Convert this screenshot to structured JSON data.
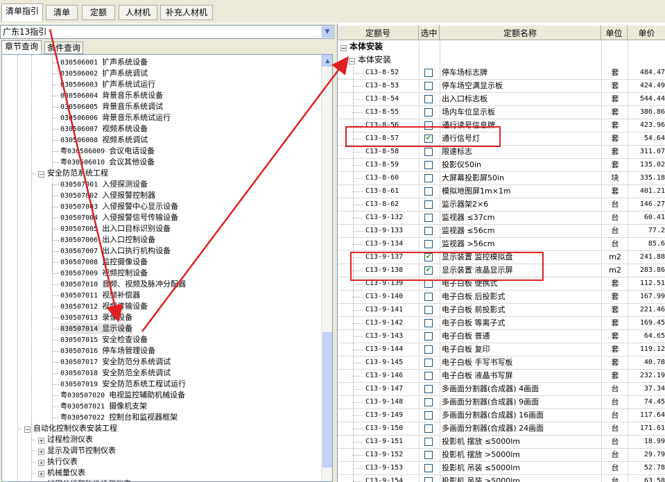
{
  "top_tabs": [
    "清单指引",
    "清单",
    "定额",
    "人材机",
    "补充人材机"
  ],
  "library": {
    "selected": "广东13指引"
  },
  "sub_tabs": [
    "章节查询",
    "条件查询"
  ],
  "tree": {
    "rows": [
      {
        "code": "030506001",
        "name": "扩声系统设备"
      },
      {
        "code": "030506002",
        "name": "扩声系统调试"
      },
      {
        "code": "030506003",
        "name": "扩声系统试运行"
      },
      {
        "code": "030506004",
        "name": "背景音乐系统设备"
      },
      {
        "code": "030506005",
        "name": "背景音乐系统调试"
      },
      {
        "code": "030506006",
        "name": "背景音乐系统试运行"
      },
      {
        "code": "030506007",
        "name": "视频系统设备"
      },
      {
        "code": "030506008",
        "name": "视频系统调试"
      },
      {
        "code": "粤030506009",
        "name": "会议电话设备"
      },
      {
        "code": "粤030506010",
        "name": "会议其他设备"
      },
      {
        "code": "",
        "name": "安全防范系统工程"
      },
      {
        "code": "030507001",
        "name": "入侵探测设备"
      },
      {
        "code": "030507002",
        "name": "入侵报警控制器"
      },
      {
        "code": "030507003",
        "name": "入侵报警中心显示设备"
      },
      {
        "code": "030507004",
        "name": "入侵报警信号传输设备"
      },
      {
        "code": "030507005",
        "name": "出入口目标识别设备"
      },
      {
        "code": "030507006",
        "name": "出入口控制设备"
      },
      {
        "code": "030507007",
        "name": "出入口执行机构设备"
      },
      {
        "code": "030507008",
        "name": "监控摄像设备"
      },
      {
        "code": "030507009",
        "name": "视频控制设备"
      },
      {
        "code": "030507010",
        "name": "音频、视频及脉冲分配器"
      },
      {
        "code": "030507011",
        "name": "视频补偿器"
      },
      {
        "code": "030507012",
        "name": "视频传输设备"
      },
      {
        "code": "030507013",
        "name": "录像设备"
      },
      {
        "code": "030507014",
        "name": "显示设备"
      },
      {
        "code": "030507015",
        "name": "安全检查设备"
      },
      {
        "code": "030507016",
        "name": "停车场管理设备"
      },
      {
        "code": "030507017",
        "name": "安全防范分系统调试"
      },
      {
        "code": "030507018",
        "name": "安全防范全系统调试"
      },
      {
        "code": "030507019",
        "name": "安全防范系统工程试运行"
      },
      {
        "code": "粤030507020",
        "name": "电视监控辅助机械设备"
      },
      {
        "code": "粤030507021",
        "name": "摄像机支架"
      },
      {
        "code": "粤030507022",
        "name": "控制台和监视器框架"
      },
      {
        "code": "",
        "name": "自动化控制仪表安装工程"
      },
      {
        "code": "",
        "name": "过程检测仪表"
      },
      {
        "code": "",
        "name": "显示及调节控制仪表"
      },
      {
        "code": "",
        "name": "执行仪表"
      },
      {
        "code": "",
        "name": "机械量仪表"
      },
      {
        "code": "",
        "name": "过程分析和物性检测仪表"
      }
    ]
  },
  "grid": {
    "headers": [
      "定额号",
      "选中",
      "定额名称",
      "单位",
      "单价"
    ],
    "group": "本体安装",
    "subgroup": "本体安装",
    "rows": [
      {
        "code": "C13-8-52",
        "checked": false,
        "name": "停车场标志牌",
        "unit": "套",
        "price": "484.47"
      },
      {
        "code": "C13-8-53",
        "checked": false,
        "name": "停车场空满显示板",
        "unit": "套",
        "price": "424.49"
      },
      {
        "code": "C13-8-54",
        "checked": false,
        "name": "出入口标志板",
        "unit": "套",
        "price": "544.44"
      },
      {
        "code": "C13-8-55",
        "checked": false,
        "name": "场内车位显示板",
        "unit": "套",
        "price": "386.86"
      },
      {
        "code": "C13-8-56",
        "checked": false,
        "name": "通行读号信息牌",
        "unit": "套",
        "price": "423.96"
      },
      {
        "code": "C13-8-57",
        "checked": true,
        "name": "通行信号灯",
        "unit": "套",
        "price": "54.64"
      },
      {
        "code": "C13-8-58",
        "checked": false,
        "name": "限速标志",
        "unit": "套",
        "price": "311.07"
      },
      {
        "code": "C13-8-59",
        "checked": false,
        "name": "投影仪50in",
        "unit": "套",
        "price": "135.02"
      },
      {
        "code": "C13-8-60",
        "checked": false,
        "name": "大屏幕投影屏50in",
        "unit": "块",
        "price": "335.18"
      },
      {
        "code": "C13-8-61",
        "checked": false,
        "name": "模拟地图屏1m×1m",
        "unit": "套",
        "price": "401.21"
      },
      {
        "code": "C13-8-62",
        "checked": false,
        "name": "监示器架2×6",
        "unit": "台",
        "price": "146.27"
      },
      {
        "code": "C13-9-132",
        "checked": false,
        "name": "监视器 ≤37cm",
        "unit": "台",
        "price": "60.41"
      },
      {
        "code": "C13-9-133",
        "checked": false,
        "name": "监视器 ≤56cm",
        "unit": "台",
        "price": "77.2"
      },
      {
        "code": "C13-9-134",
        "checked": false,
        "name": "监视器 >56cm",
        "unit": "台",
        "price": "85.6"
      },
      {
        "code": "C13-9-137",
        "checked": true,
        "name": "显示装置 监控模拟盘",
        "unit": "m2",
        "price": "241.88"
      },
      {
        "code": "C13-9-138",
        "checked": true,
        "name": "显示装置 液晶显示屏",
        "unit": "m2",
        "price": "283.86"
      },
      {
        "code": "C13-9-139",
        "checked": false,
        "name": "电子白板 便携式",
        "unit": "套",
        "price": "112.51"
      },
      {
        "code": "C13-9-140",
        "checked": false,
        "name": "电子白板 后投影式",
        "unit": "套",
        "price": "167.99"
      },
      {
        "code": "C13-9-141",
        "checked": false,
        "name": "电子白板 前投影式",
        "unit": "套",
        "price": "221.46"
      },
      {
        "code": "C13-9-142",
        "checked": false,
        "name": "电子白板 等离子式",
        "unit": "套",
        "price": "169.45"
      },
      {
        "code": "C13-9-143",
        "checked": false,
        "name": "电子白板 普通",
        "unit": "套",
        "price": "64.65"
      },
      {
        "code": "C13-9-144",
        "checked": false,
        "name": "电子白板 复印",
        "unit": "套",
        "price": "119.12"
      },
      {
        "code": "C13-9-145",
        "checked": false,
        "name": "电子白板 手写书写板",
        "unit": "套",
        "price": "40.78"
      },
      {
        "code": "C13-9-146",
        "checked": false,
        "name": "电子白板 液晶书写屏",
        "unit": "套",
        "price": "232.19"
      },
      {
        "code": "C13-9-147",
        "checked": false,
        "name": "多画面分割器(合成器) 4画面",
        "unit": "台",
        "price": "37.34"
      },
      {
        "code": "C13-9-148",
        "checked": false,
        "name": "多画面分割器(合成器) 9画面",
        "unit": "台",
        "price": "74.45"
      },
      {
        "code": "C13-9-149",
        "checked": false,
        "name": "多画面分割器(合成器) 16画面",
        "unit": "台",
        "price": "117.64"
      },
      {
        "code": "C13-9-150",
        "checked": false,
        "name": "多画面分割器(合成器) 24画面",
        "unit": "台",
        "price": "171.61"
      },
      {
        "code": "C13-9-151",
        "checked": false,
        "name": "投影机 摆放 ≤5000lm",
        "unit": "台",
        "price": "18.99"
      },
      {
        "code": "C13-9-152",
        "checked": false,
        "name": "投影机 摆放 >5000lm",
        "unit": "台",
        "price": "29.79"
      },
      {
        "code": "C13-9-153",
        "checked": false,
        "name": "投影机 吊装 ≤5000lm",
        "unit": "台",
        "price": "52.78"
      },
      {
        "code": "C13-9-154",
        "checked": false,
        "name": "投影机 吊装 >5000lm",
        "unit": "台",
        "price": "63.58"
      }
    ]
  },
  "colors": {
    "annotation": "#e02020",
    "check": "#21a121"
  }
}
